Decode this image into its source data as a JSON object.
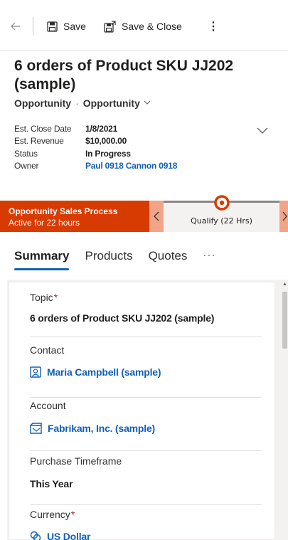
{
  "commandbar": {
    "save_label": "Save",
    "save_close_label": "Save & Close",
    "more_label": "⋮"
  },
  "header": {
    "title": "6 orders of Product SKU JJ202 (sample)",
    "entity": "Opportunity",
    "form": "Opportunity",
    "fields": [
      {
        "label": "Est. Close Date",
        "value": "1/8/2021"
      },
      {
        "label": "Est. Revenue",
        "value": "$10,000.00"
      },
      {
        "label": "Status",
        "value": "In Progress"
      },
      {
        "label": "Owner",
        "value": "Paul 0918 Cannon 0918"
      }
    ]
  },
  "bpf": {
    "name": "Opportunity Sales Process",
    "duration": "Active for 22 hours",
    "stage": "Qualify (22 Hrs)"
  },
  "tabs": [
    {
      "label": "Summary"
    },
    {
      "label": "Products"
    },
    {
      "label": "Quotes"
    },
    {
      "label": "···"
    }
  ],
  "form": {
    "topic": {
      "label": "Topic",
      "value": "6 orders of Product SKU JJ202 (sample)"
    },
    "contact": {
      "label": "Contact",
      "value": "Maria Campbell (sample)"
    },
    "account": {
      "label": "Account",
      "value": "Fabrikam, Inc. (sample)"
    },
    "timeframe": {
      "label": "Purchase Timeframe",
      "value": "This Year"
    },
    "currency": {
      "label": "Currency",
      "value": "US Dollar"
    },
    "required_marker": "*"
  },
  "colors": {
    "accent": "#1160b7",
    "bpf_active": "#d83b01",
    "required": "#a4262c"
  }
}
